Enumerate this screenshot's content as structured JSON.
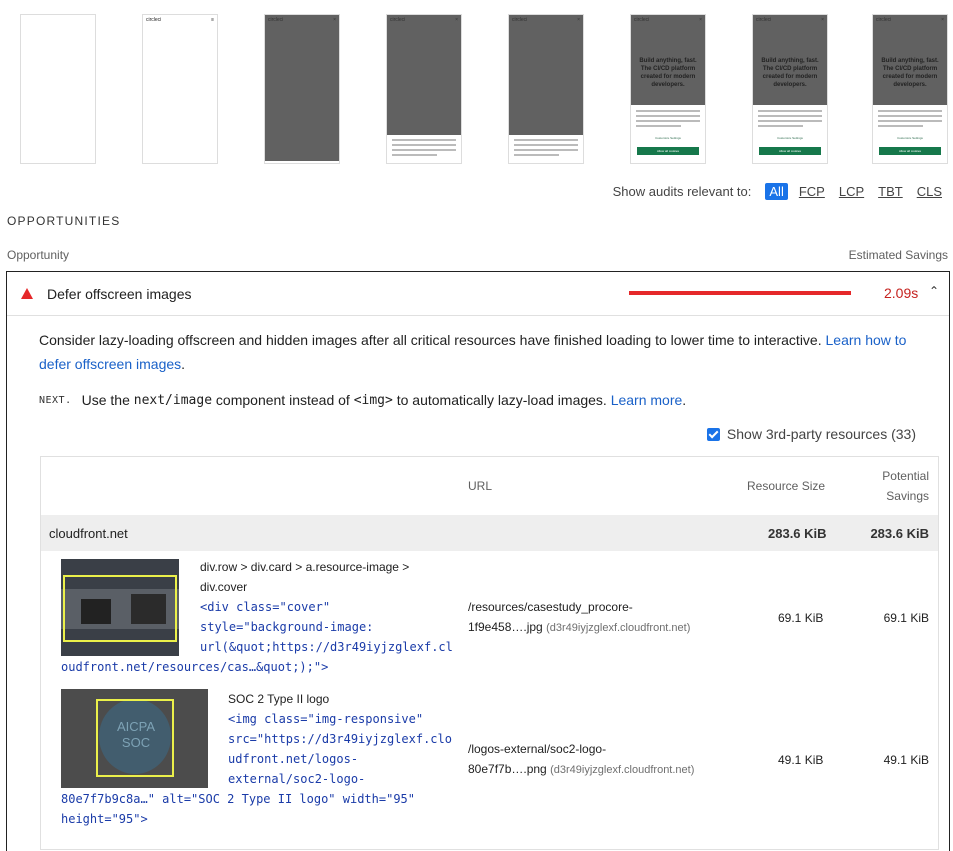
{
  "filmstrip": {
    "brand": "circleci",
    "hero_text": "Build anything, fast. The CI/CD platform created for modern developers.",
    "button_label": "Allow all cookies",
    "alt_button_label": "Customize Settings"
  },
  "filter": {
    "label": "Show audits relevant to:",
    "options": [
      "All",
      "FCP",
      "LCP",
      "TBT",
      "CLS"
    ]
  },
  "section_title": "OPPORTUNITIES",
  "columns": {
    "opportunity": "Opportunity",
    "savings": "Estimated Savings"
  },
  "audit": {
    "title": "Defer offscreen images",
    "savings": "2.09s",
    "description": "Consider lazy-loading offscreen and hidden images after all critical resources have finished loading to lower time to interactive. ",
    "learn_link": "Learn how to defer offscreen images",
    "stack_logo": "NEXT.",
    "stack_pre": "Use the ",
    "stack_code1": "next/image",
    "stack_mid": " component instead of ",
    "stack_code2": "<img>",
    "stack_post": " to automatically lazy-load images. ",
    "stack_link": "Learn more",
    "third_party": "Show 3rd-party resources (33)"
  },
  "table": {
    "headers": {
      "url": "URL",
      "size": "Resource Size",
      "potential": "Potential",
      "savings": "Savings"
    },
    "group": {
      "name": "cloudfront.net",
      "size": "283.6 KiB",
      "savings": "283.6 KiB"
    },
    "rows": [
      {
        "selector1": "div.row > div.card > a.resource-image >",
        "selector2": "div.cover",
        "code1": "<div class=\"cover\"",
        "code2": "style=\"background-image:",
        "code3": "url(&quot;https://d3r49iyjzglexf.cl",
        "code4": "oudfront.net/resources/cas…&quot;);\">",
        "url1": "/resources/casestudy_procore-",
        "url2": "1f9e458….jpg",
        "host": "(d3r49iyjzglexf.cloudfront.net)",
        "size": "69.1 KiB",
        "savings": "69.1 KiB"
      },
      {
        "selector1": "SOC 2 Type II logo",
        "code1": "<img class=\"img-responsive\"",
        "code2": "src=\"https://d3r49iyjzglexf.clo",
        "code3": "udfront.net/logos-",
        "code4": "external/soc2-logo-",
        "code5": "80e7f7b9c8a…\" alt=\"SOC 2 Type II logo\" width=\"95\"",
        "code6": "height=\"95\">",
        "url1": "/logos-external/soc2-logo-",
        "url2": "80e7f7b….png",
        "host": "(d3r49iyjzglexf.cloudfront.net)",
        "size": "49.1 KiB",
        "savings": "49.1 KiB",
        "logo_text1": "AICPA",
        "logo_text2": "SOC"
      }
    ]
  }
}
